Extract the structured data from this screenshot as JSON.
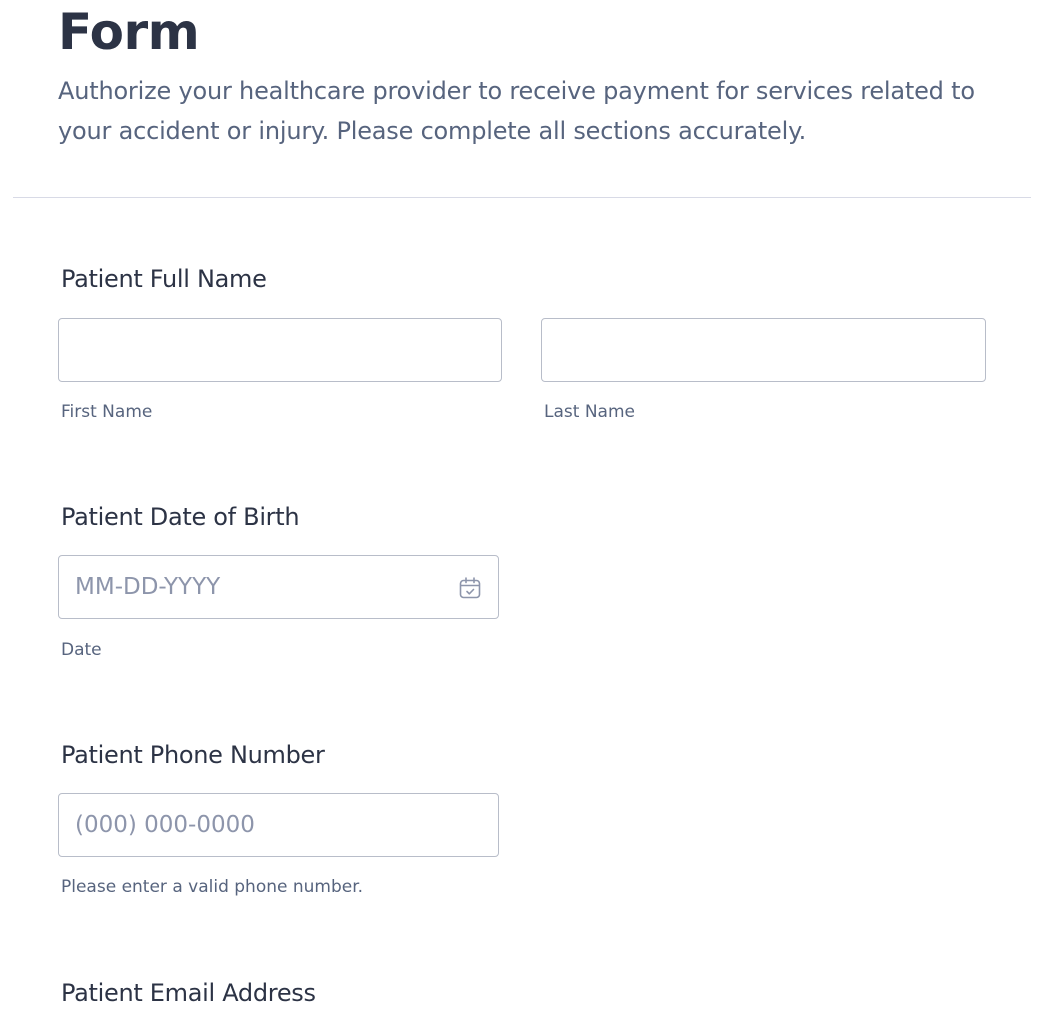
{
  "header": {
    "title": "Form",
    "subtitle": "Authorize your healthcare provider to receive payment for services related to your accident or injury. Please complete all sections accurately."
  },
  "fields": {
    "full_name": {
      "label": "Patient Full Name",
      "first_name": {
        "value": "",
        "sublabel": "First Name"
      },
      "last_name": {
        "value": "",
        "sublabel": "Last Name"
      }
    },
    "date_of_birth": {
      "label": "Patient Date of Birth",
      "value": "",
      "placeholder": "MM-DD-YYYY",
      "sublabel": "Date",
      "icon": "calendar-icon"
    },
    "phone": {
      "label": "Patient Phone Number",
      "value": "",
      "placeholder": "(000) 000-0000",
      "sublabel": "Please enter a valid phone number."
    },
    "email": {
      "label": "Patient Email Address"
    }
  },
  "colors": {
    "heading": "#2c3345",
    "text_muted": "#57647e",
    "placeholder": "#8d95ab",
    "input_border": "#b8bdc9",
    "divider": "#d8dae6"
  }
}
